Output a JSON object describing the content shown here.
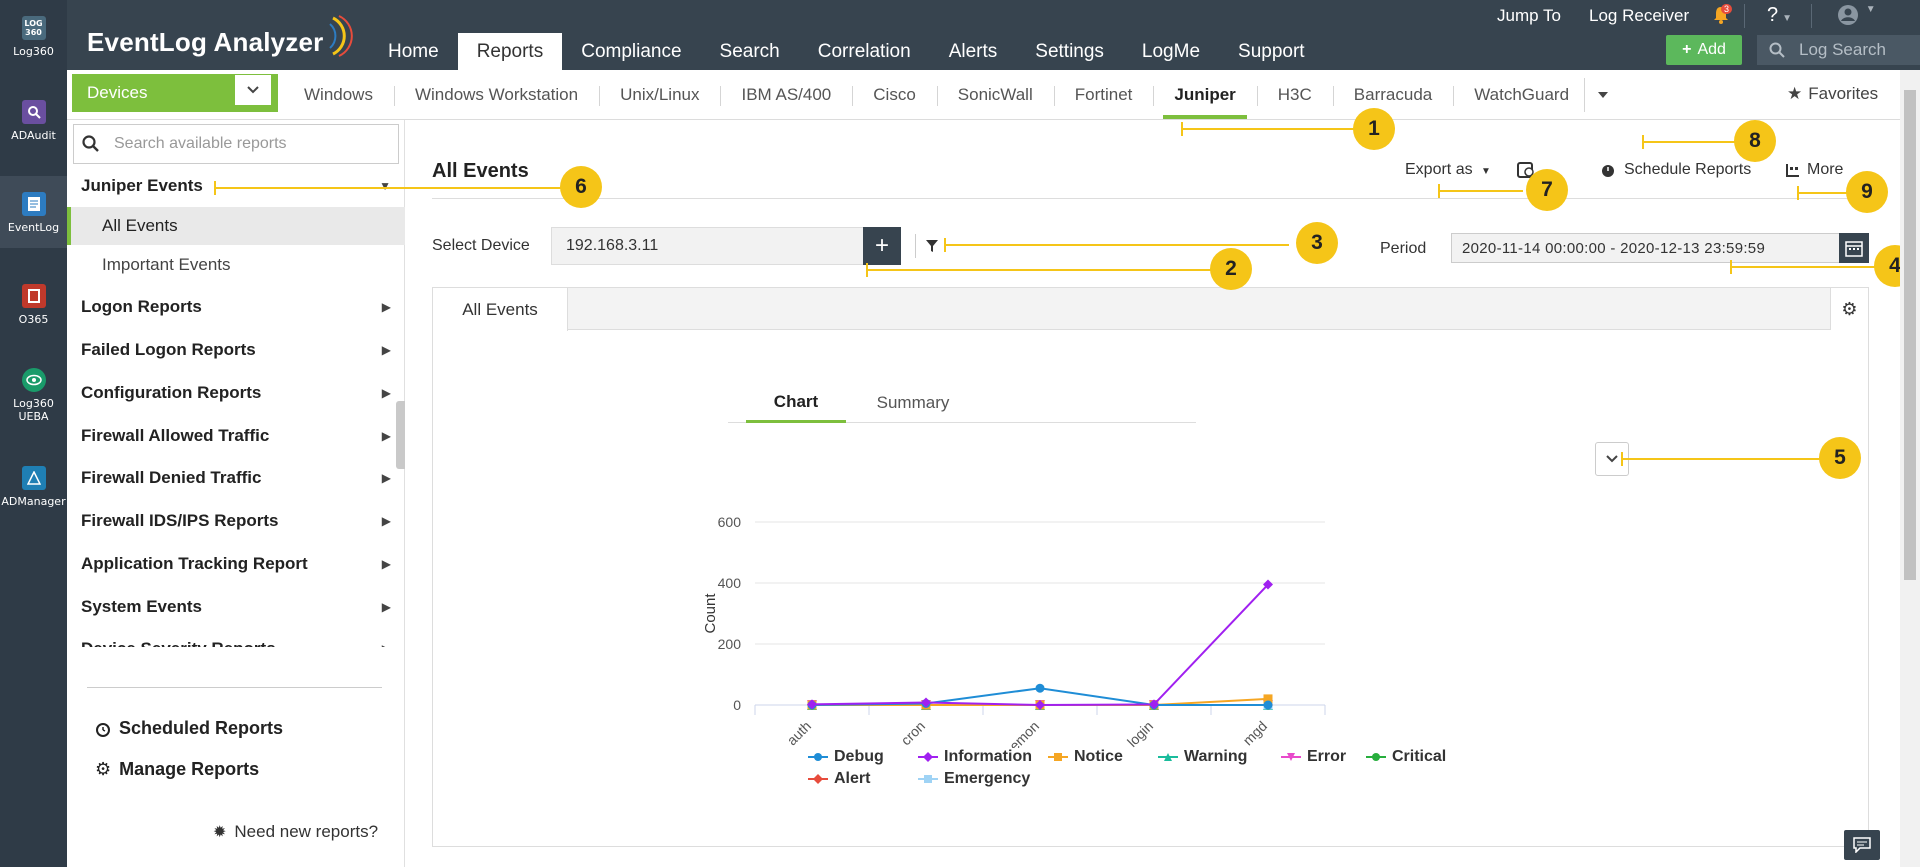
{
  "rail": {
    "items": [
      {
        "label": "Log360",
        "icon": "log360-icon",
        "color": "#4a6a7d",
        "badge": "LOG 360"
      },
      {
        "label": "ADAudit",
        "icon": "adaudit-icon",
        "color": "#6a4fa0",
        "badge": "Q"
      },
      {
        "label": "EventLog",
        "icon": "eventlog-icon",
        "color": "#2d7cc1",
        "badge": "E"
      },
      {
        "label": "O365",
        "icon": "o365-icon",
        "color": "#c0392b",
        "badge": "O"
      },
      {
        "label": "Log360 UEBA",
        "icon": "ueba-icon",
        "color": "#1a9b6a",
        "badge": "U"
      },
      {
        "label": "ADManager",
        "icon": "admanager-icon",
        "color": "#1f7fb4",
        "badge": "A"
      }
    ]
  },
  "header": {
    "logo": "EventLog Analyzer",
    "jump_to": "Jump To",
    "log_receiver": "Log Receiver",
    "alert_count": "3",
    "help": "?",
    "add_label": "Add",
    "search_placeholder": "Log Search",
    "tabs": [
      "Home",
      "Reports",
      "Compliance",
      "Search",
      "Correlation",
      "Alerts",
      "Settings",
      "LogMe",
      "Support"
    ],
    "active_tab": "Reports"
  },
  "devbar": {
    "devices_label": "Devices",
    "tabs": [
      "Windows",
      "Windows Workstation",
      "Unix/Linux",
      "IBM AS/400",
      "Cisco",
      "SonicWall",
      "Fortinet",
      "Juniper",
      "H3C",
      "Barracuda",
      "WatchGuard"
    ],
    "active_tab": "Juniper",
    "favorites": "Favorites"
  },
  "sidebar": {
    "search_placeholder": "Search available reports",
    "group_open": "Juniper Events",
    "sub_items": [
      "All Events",
      "Important Events"
    ],
    "active_sub": "All Events",
    "groups": [
      "Logon Reports",
      "Failed Logon Reports",
      "Configuration Reports",
      "Firewall Allowed Traffic",
      "Firewall Denied Traffic",
      "Firewall IDS/IPS Reports",
      "Application Tracking Report",
      "System Events",
      "Device Severity Reports"
    ],
    "scheduled_reports": "Scheduled Reports",
    "manage_reports": "Manage Reports",
    "need_new": "Need new reports?"
  },
  "report": {
    "title": "All Events",
    "export_as": "Export as",
    "schedule_reports": "Schedule Reports",
    "more": "More",
    "select_device_label": "Select Device",
    "device_value": "192.168.3.11",
    "period_label": "Period",
    "period_value": "2020-11-14 00:00:00 - 2020-12-13 23:59:59",
    "panel_tab": "All Events",
    "chart_tab": "Chart",
    "summary_tab": "Summary"
  },
  "chart_data": {
    "type": "line",
    "categories": [
      "auth",
      "cron",
      "daemon",
      "login",
      "mgd"
    ],
    "ylabel": "Count",
    "ylim": [
      0,
      600
    ],
    "yticks": [
      0,
      200,
      400,
      600
    ],
    "series": [
      {
        "name": "Debug",
        "color": "#1f8dd6",
        "marker": "circle",
        "values": [
          0,
          5,
          55,
          0,
          0
        ]
      },
      {
        "name": "Information",
        "color": "#a020f0",
        "marker": "diamond",
        "values": [
          2,
          8,
          0,
          2,
          395
        ]
      },
      {
        "name": "Notice",
        "color": "#f5a623",
        "marker": "square",
        "values": [
          0,
          0,
          0,
          0,
          20
        ]
      },
      {
        "name": "Warning",
        "color": "#1abc9c",
        "marker": "triangle",
        "values": [
          0,
          0,
          0,
          0,
          0
        ]
      },
      {
        "name": "Error",
        "color": "#e84acb",
        "marker": "triangle-down",
        "values": [
          0,
          0,
          0,
          0,
          0
        ]
      },
      {
        "name": "Critical",
        "color": "#27ae3d",
        "marker": "circle",
        "values": [
          0,
          0,
          0,
          0,
          0
        ]
      },
      {
        "name": "Alert",
        "color": "#e74c3c",
        "marker": "diamond",
        "values": [
          0,
          0,
          0,
          0,
          0
        ]
      },
      {
        "name": "Emergency",
        "color": "#9fd3f5",
        "marker": "square",
        "values": [
          0,
          0,
          0,
          0,
          0
        ]
      }
    ]
  },
  "callouts": [
    "1",
    "2",
    "3",
    "4",
    "5",
    "6",
    "7",
    "8",
    "9"
  ],
  "colors": {
    "accent": "#7dbf3d",
    "header_bg": "#37444f",
    "callout": "#f5c518"
  }
}
